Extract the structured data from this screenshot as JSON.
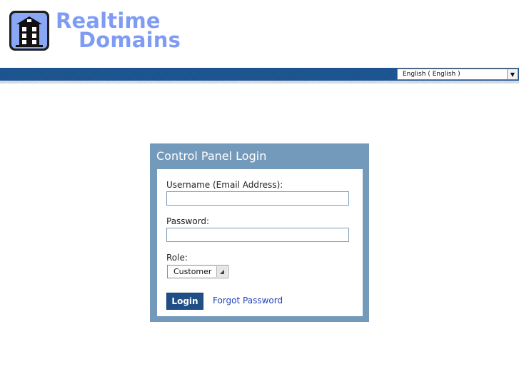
{
  "logo": {
    "line1": "Realtime",
    "line2": "Domains"
  },
  "language_select": {
    "value": "English ( English )",
    "icon": "chevron-down-icon"
  },
  "login_panel": {
    "title": "Control Panel Login",
    "username_label": "Username (Email Address):",
    "username_value": "",
    "password_label": "Password:",
    "password_value": "",
    "role_label": "Role:",
    "role_value": "Customer",
    "login_label": "Login",
    "forgot_label": "Forgot Password"
  },
  "colors": {
    "brand_text": "#7f9cf5",
    "top_bar": "#1f5a97",
    "panel": "#7399bb",
    "button": "#1f4f86",
    "link": "#2146b8"
  }
}
